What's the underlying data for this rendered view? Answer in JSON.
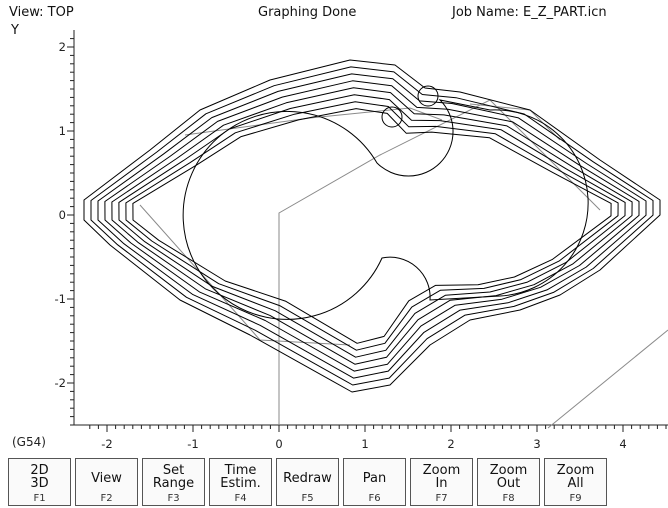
{
  "header": {
    "view": "View: TOP",
    "status": "Graphing Done",
    "job_name": "Job Name: E_Z_PART.icn"
  },
  "axes": {
    "y_label": "Y",
    "x_ticks": [
      "-2",
      "-1",
      "0",
      "1",
      "2",
      "3",
      "4"
    ],
    "y_ticks": [
      "2",
      "1",
      "0",
      "-1",
      "-2"
    ]
  },
  "wcs": "(G54)",
  "function_keys": [
    {
      "label": "2D\n3D",
      "key": "F1"
    },
    {
      "label": "View",
      "key": "F2"
    },
    {
      "label": "Set\nRange",
      "key": "F3"
    },
    {
      "label": "Time\nEstim.",
      "key": "F4"
    },
    {
      "label": "Redraw",
      "key": "F5"
    },
    {
      "label": "Pan",
      "key": "F6"
    },
    {
      "label": "Zoom\nIn",
      "key": "F7"
    },
    {
      "label": "Zoom\nOut",
      "key": "F8"
    },
    {
      "label": "Zoom\nAll",
      "key": "F9"
    }
  ],
  "colors": {
    "toolpath": "#000000",
    "rapid": "#8a8a8a",
    "axis": "#222222"
  }
}
